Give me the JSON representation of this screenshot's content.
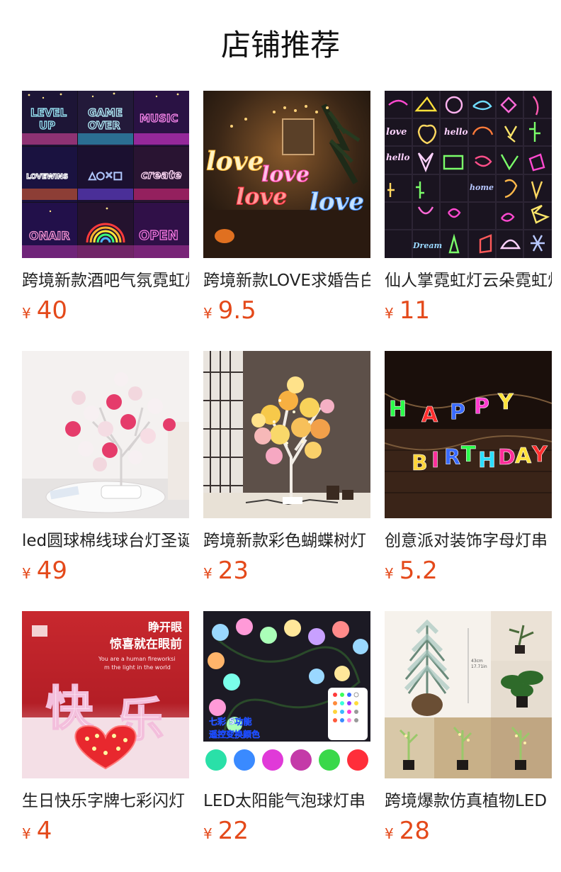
{
  "header": {
    "title": "店铺推荐"
  },
  "colors": {
    "price": "#e4491a",
    "title": "#111111",
    "name": "#222222"
  },
  "products": [
    {
      "name": "跨境新款酒吧气氛霓虹灯",
      "currency": "¥",
      "price": "40",
      "image_icon": "neon-signs-collage-image"
    },
    {
      "name": "跨境新款LOVE求婚告白灯",
      "currency": "¥",
      "price": "9.5",
      "image_icon": "love-neon-image"
    },
    {
      "name": "仙人掌霓虹灯云朵霓虹灯",
      "currency": "¥",
      "price": "11",
      "image_icon": "neon-shapes-grid-image"
    },
    {
      "name": "led圆球棉线球台灯圣诞",
      "currency": "¥",
      "price": "49",
      "image_icon": "cotton-ball-lamp-image"
    },
    {
      "name": "跨境新款彩色蝴蝶树灯",
      "currency": "¥",
      "price": "23",
      "image_icon": "butterfly-tree-lamp-image"
    },
    {
      "name": "创意派对装饰字母灯串",
      "currency": "¥",
      "price": "5.2",
      "image_icon": "happy-birthday-lights-image"
    },
    {
      "name": "生日快乐字牌七彩闪灯",
      "currency": "¥",
      "price": "4",
      "image_icon": "birthday-marquee-letters-image"
    },
    {
      "name": "LED太阳能气泡球灯串",
      "currency": "¥",
      "price": "22",
      "image_icon": "bubble-ball-string-lights-image"
    },
    {
      "name": "跨境爆款仿真植物LED",
      "currency": "¥",
      "price": "28",
      "image_icon": "artificial-plant-lamp-image"
    }
  ],
  "image_texts": {
    "p0": {
      "s1": "LEVEL",
      "s2": "UP",
      "s3": "GAME",
      "s4": "OVER",
      "s5": "MUSIC",
      "s6": "LOVEWINS",
      "s7": "△○✕□",
      "s8": "create",
      "s9": "ONAIR",
      "s10": "OPEN"
    },
    "p1": {
      "a": "love",
      "b": "love",
      "c": "love",
      "d": "love"
    },
    "p2": {
      "a": "love",
      "b": "hello",
      "c": "hello",
      "d": "home",
      "e": "Dream"
    },
    "p5": {
      "letters1": [
        "H",
        "A",
        "P",
        "P",
        "Y"
      ],
      "letters2": [
        "B",
        "I",
        "R",
        "T",
        "H",
        "D",
        "A",
        "Y"
      ]
    },
    "p6": {
      "t1": "睁开眼",
      "t2": "惊喜就在眼前",
      "t3": "You are a human fireworksi",
      "t4": "m the light in the world",
      "t5": "快",
      "t6": "乐"
    },
    "p7": {
      "t1": "七彩 5功能",
      "t2": "遥控变换颜色"
    },
    "p8": {
      "t1": "43cm",
      "t2": "17.71in"
    }
  }
}
